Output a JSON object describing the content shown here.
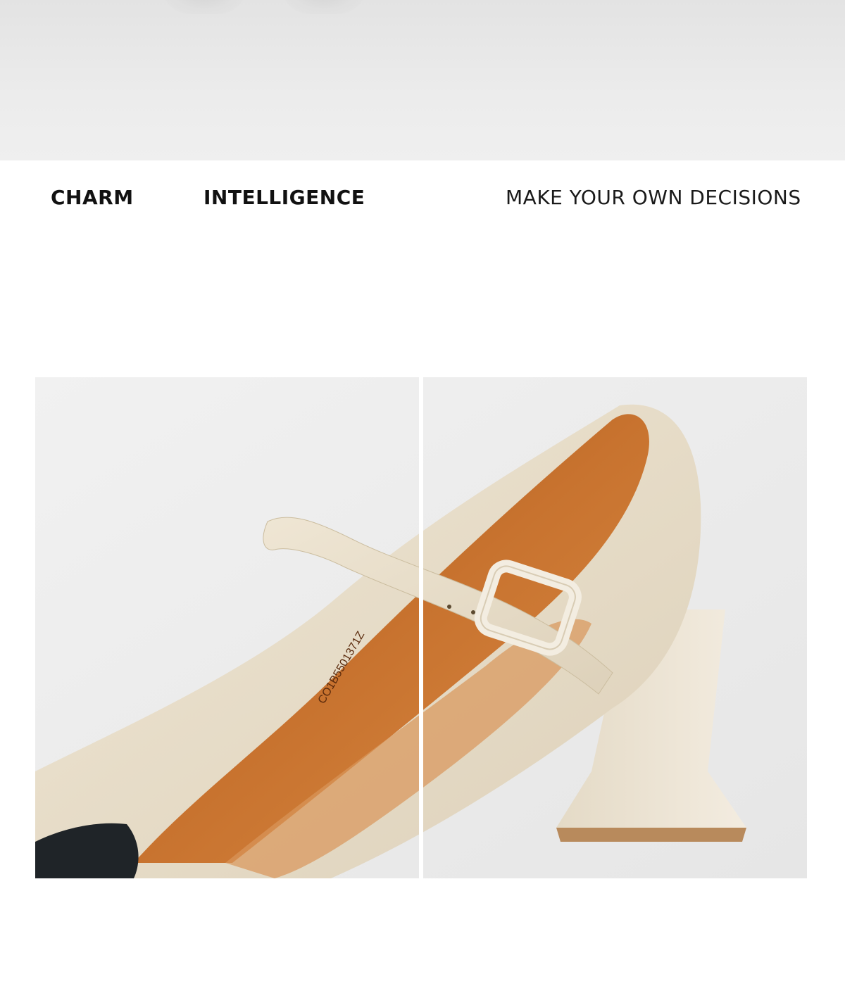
{
  "taglines": {
    "charm": "CHARM",
    "intelligence": "INTELLIGENCE",
    "decisions": "MAKE YOUR OWN DECISIONS"
  },
  "product_photo": {
    "insole_code": "CO1B5501371Z"
  },
  "colors": {
    "background": "#ffffff",
    "top_band": "#e8e8e8",
    "leather_cream": "#e9dfcc",
    "lining_tan": "#c46a2a",
    "toe_cap": "#1f2428"
  }
}
